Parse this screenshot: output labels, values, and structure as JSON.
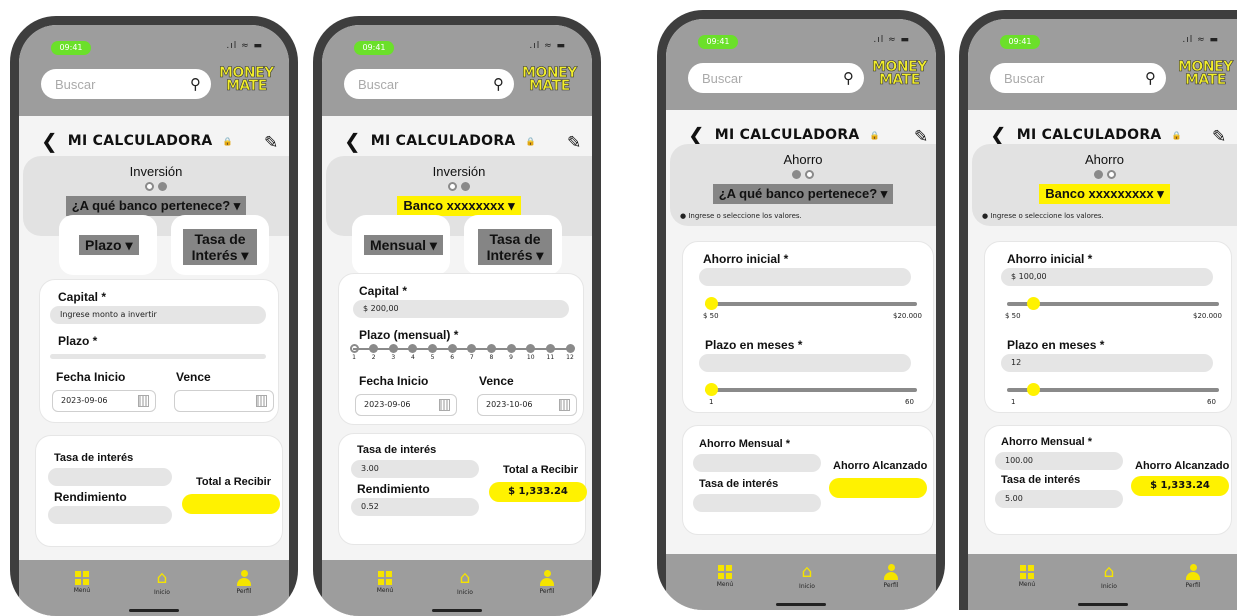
{
  "status": {
    "time": "09:41",
    "signal": ".ıl ≈ ▬"
  },
  "search": {
    "placeholder": "Buscar"
  },
  "logo": {
    "line1": "MONEY",
    "line2": "MATE"
  },
  "header": {
    "title": "MI CALCULADORA",
    "back_icon": "back-arrow-icon",
    "edit_icon": "pencil-icon"
  },
  "nav": {
    "items": [
      {
        "label": "Menú",
        "icon": "grid-icon"
      },
      {
        "label": "Inicio",
        "icon": "home-icon"
      },
      {
        "label": "Perfil",
        "icon": "person-icon"
      }
    ]
  },
  "colors": {
    "accent": "#fff200",
    "frame": "#3e3e3e",
    "bar": "#9d9d9d"
  },
  "screens": [
    {
      "section": "Inversión",
      "bank": "¿A qué banco pertenece?",
      "tabs": {
        "period": "Plazo",
        "rate_line1": "Tasa de",
        "rate_line2": "Interés"
      },
      "capital_label": "Capital *",
      "capital_placeholder": "Ingrese monto a invertir",
      "plazo_label": "Plazo *",
      "start_label": "Fecha Inicio",
      "start_date": "2023-09-06",
      "due_label": "Vence",
      "rate_label": "Tasa de interés",
      "yield_label": "Rendimiento",
      "total_label": "Total a Recibir"
    },
    {
      "section": "Inversión",
      "bank": "Banco xxxxxxxx",
      "tabs": {
        "period": "Mensual",
        "rate_line1": "Tasa de",
        "rate_line2": "Interés"
      },
      "capital_label": "Capital *",
      "capital_value": "$ 200,00",
      "plazo_label": "Plazo (mensual) *",
      "months": [
        "1",
        "2",
        "3",
        "4",
        "5",
        "6",
        "7",
        "8",
        "9",
        "10",
        "11",
        "12"
      ],
      "selected_month": 1,
      "start_label": "Fecha Inicio",
      "start_date": "2023-09-06",
      "due_label": "Vence",
      "due_date": "2023-10-06",
      "rate_label": "Tasa de interés",
      "rate_value": "3.00",
      "yield_label": "Rendimiento",
      "yield_value": "0.52",
      "total_label": "Total a Recibir",
      "total_value": "$ 1,333.24"
    },
    {
      "section": "Ahorro",
      "bank": "¿A qué banco pertenece?",
      "hint": "Ingrese o seleccione los valores.",
      "initial_label": "Ahorro inicial *",
      "initial_min": "$ 50",
      "initial_max": "$20.000",
      "initial_level": 0.0,
      "months_label": "Plazo en meses *",
      "months_min": "1",
      "months_max": "60",
      "months_level": 0.0,
      "monthly_label": "Ahorro Mensual *",
      "rate_label": "Tasa de interés",
      "reached_label": "Ahorro Alcanzado"
    },
    {
      "section": "Ahorro",
      "bank": "Banco xxxxxxxxx",
      "hint": "Ingrese o seleccione los valores.",
      "initial_label": "Ahorro inicial *",
      "initial_value": "$ 100,00",
      "initial_min": "$ 50",
      "initial_max": "$20.000",
      "initial_level": 0.1,
      "months_label": "Plazo en meses *",
      "months_value": "12",
      "months_min": "1",
      "months_max": "60",
      "months_level": 0.1,
      "monthly_label": "Ahorro Mensual *",
      "monthly_value": "100.00",
      "rate_label": "Tasa de interés",
      "rate_value": "5.00",
      "reached_label": "Ahorro Alcanzado",
      "reached_value": "$ 1,333.24"
    }
  ]
}
